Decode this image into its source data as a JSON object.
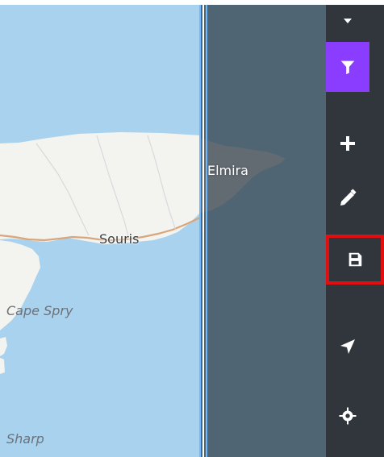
{
  "map": {
    "labels": {
      "elmira": "Elmira",
      "souris": "Souris",
      "cape_spry": "Cape Spry",
      "sharp": "Sharp"
    },
    "colors": {
      "water_left": "#a9d2ee",
      "water_right": "#4f6574",
      "land": "#f3f4f0",
      "road": "#d9a57a",
      "divider": "#6fb9ff"
    }
  },
  "toolbar": {
    "buttons": [
      {
        "name": "collapse-button",
        "icon": "chevron-down-icon"
      },
      {
        "name": "filter-button",
        "icon": "filter-icon",
        "active": true
      },
      {
        "name": "add-button",
        "icon": "plus-icon"
      },
      {
        "name": "edit-button",
        "icon": "pencil-icon"
      },
      {
        "name": "save-button",
        "icon": "save-icon",
        "highlighted": true
      },
      {
        "name": "navigate-button",
        "icon": "navigation-arrow-icon"
      },
      {
        "name": "locate-button",
        "icon": "crosshair-icon"
      }
    ],
    "colors": {
      "background": "#30363c",
      "active": "#8b3dff",
      "highlight": "#e10f0f",
      "icon": "#ffffff"
    }
  }
}
